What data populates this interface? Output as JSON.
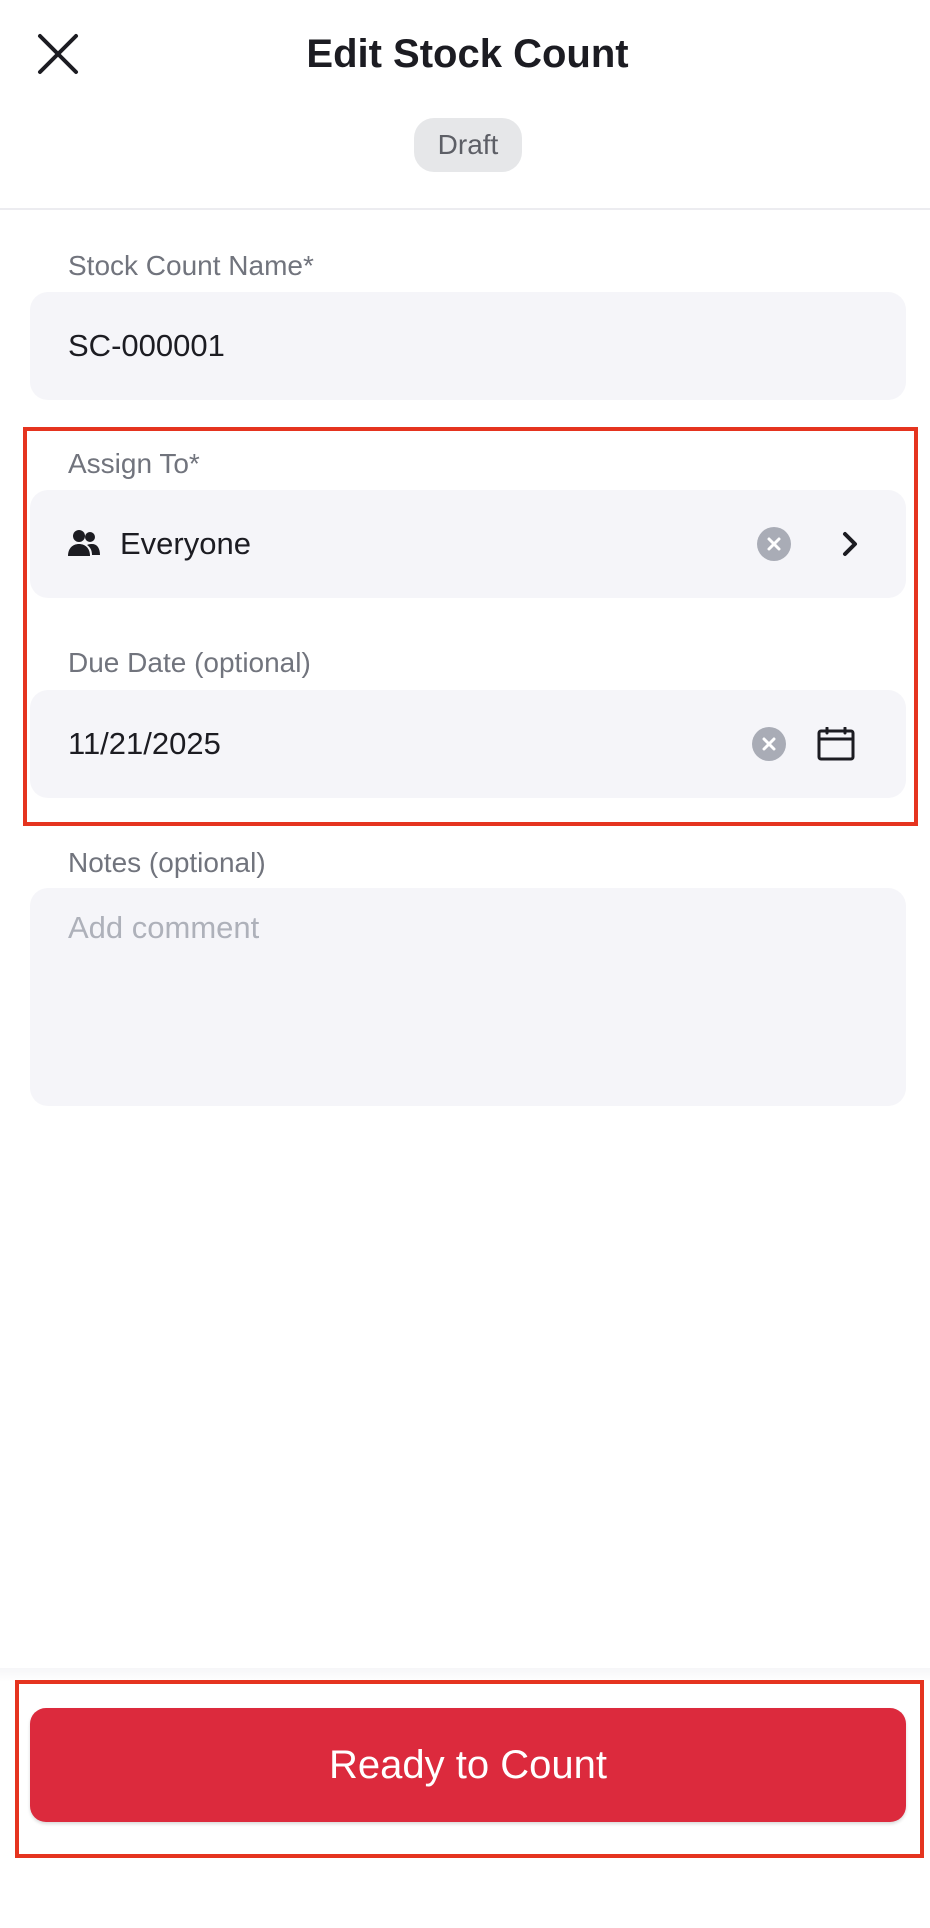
{
  "header": {
    "title": "Edit Stock Count",
    "status_badge": "Draft",
    "close_icon": "close-icon"
  },
  "form": {
    "name": {
      "label": "Stock Count Name*",
      "value": "SC-000001"
    },
    "assign_to": {
      "label": "Assign To*",
      "value": "Everyone",
      "icon": "people-icon",
      "clear_icon": "clear-icon",
      "chevron_icon": "chevron-right-icon"
    },
    "due_date": {
      "label": "Due Date (optional)",
      "value": "11/21/2025",
      "clear_icon": "clear-icon",
      "calendar_icon": "calendar-icon"
    },
    "notes": {
      "label": "Notes (optional)",
      "placeholder": "Add comment",
      "value": ""
    }
  },
  "footer": {
    "primary_button": "Ready to Count"
  },
  "colors": {
    "accent": "#dc2a3d",
    "field_bg": "#f5f5f9",
    "label": "#71747d",
    "highlight": "#e5341f"
  }
}
